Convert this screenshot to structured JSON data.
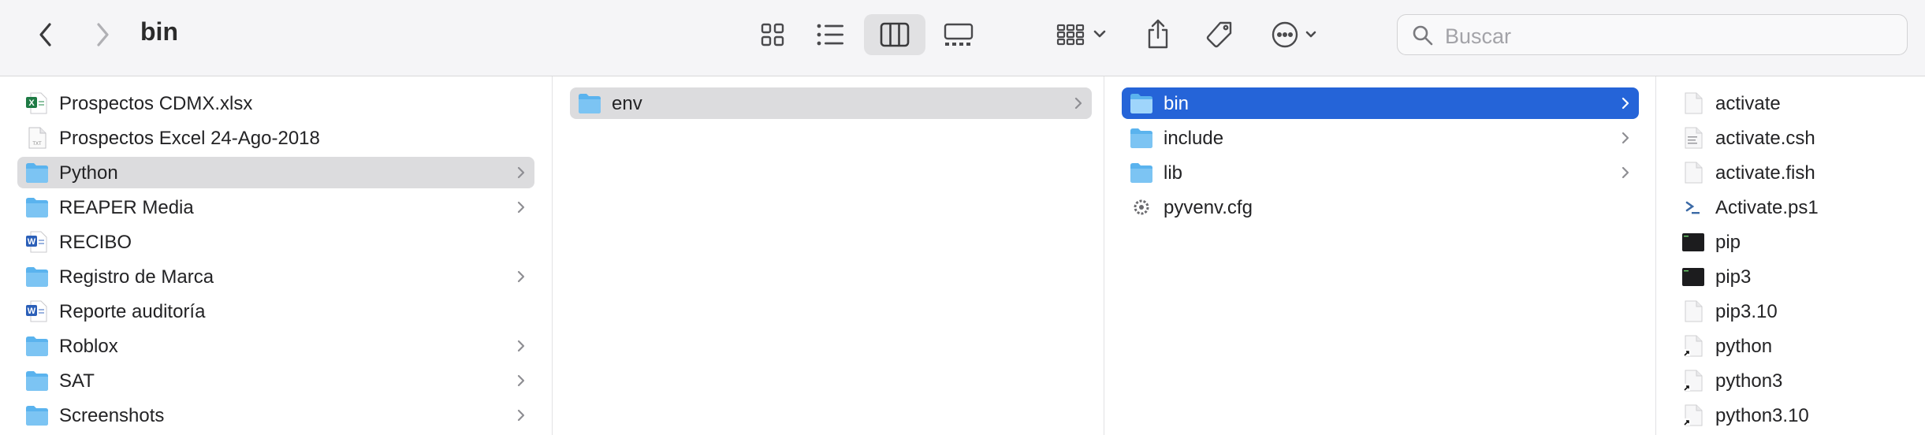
{
  "window": {
    "title": "bin"
  },
  "toolbar": {
    "back": "back",
    "forward": "forward",
    "views": [
      "icon-view",
      "list-view",
      "column-view",
      "gallery-view"
    ],
    "active_view": "column-view",
    "search_placeholder": "Buscar"
  },
  "columns": [
    {
      "items": [
        {
          "label": "Prospectos CDMX.xlsx",
          "icon": "excel-file-icon",
          "folder": false
        },
        {
          "label": "Prospectos Excel 24-Ago-2018",
          "icon": "text-file-icon",
          "folder": false
        },
        {
          "label": "Python",
          "icon": "folder-icon",
          "folder": true,
          "selected": "inactive"
        },
        {
          "label": "REAPER Media",
          "icon": "folder-icon",
          "folder": true
        },
        {
          "label": "RECIBO",
          "icon": "word-file-icon",
          "folder": false
        },
        {
          "label": "Registro de Marca",
          "icon": "folder-icon",
          "folder": true
        },
        {
          "label": "Reporte auditoría",
          "icon": "word-file-icon",
          "folder": false
        },
        {
          "label": "Roblox",
          "icon": "folder-icon",
          "folder": true
        },
        {
          "label": "SAT",
          "icon": "folder-icon",
          "folder": true
        },
        {
          "label": "Screenshots",
          "icon": "folder-icon",
          "folder": true
        }
      ]
    },
    {
      "items": [
        {
          "label": "env",
          "icon": "folder-icon",
          "folder": true,
          "selected": "inactive"
        }
      ]
    },
    {
      "items": [
        {
          "label": "bin",
          "icon": "folder-icon",
          "folder": true,
          "selected": "active"
        },
        {
          "label": "include",
          "icon": "folder-icon",
          "folder": true
        },
        {
          "label": "lib",
          "icon": "folder-icon",
          "folder": true
        },
        {
          "label": "pyvenv.cfg",
          "icon": "config-file-icon",
          "folder": false
        }
      ]
    },
    {
      "items": [
        {
          "label": "activate",
          "icon": "document-icon"
        },
        {
          "label": "activate.csh",
          "icon": "script-document-icon"
        },
        {
          "label": "activate.fish",
          "icon": "document-icon"
        },
        {
          "label": "Activate.ps1",
          "icon": "powershell-icon"
        },
        {
          "label": "pip",
          "icon": "terminal-exec-icon"
        },
        {
          "label": "pip3",
          "icon": "terminal-exec-icon"
        },
        {
          "label": "pip3.10",
          "icon": "document-icon"
        },
        {
          "label": "python",
          "icon": "alias-document-icon"
        },
        {
          "label": "python3",
          "icon": "alias-document-icon"
        },
        {
          "label": "python3.10",
          "icon": "alias-document-icon"
        }
      ]
    }
  ],
  "colors": {
    "selection_active": "#2564d8",
    "selection_inactive": "#dcdcde",
    "folder": "#5ab3ee"
  }
}
